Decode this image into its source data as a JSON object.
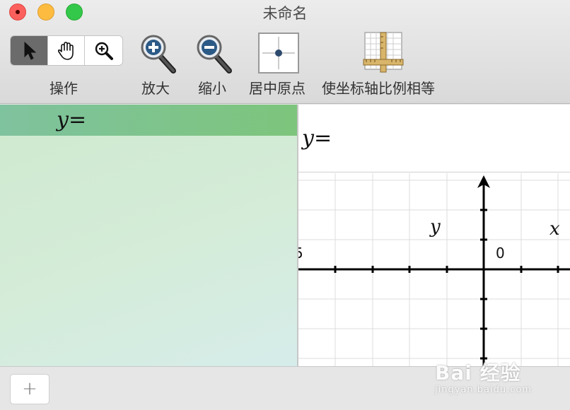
{
  "window": {
    "title": "未命名"
  },
  "toolbar": {
    "operate_label": "操作",
    "zoom_in_label": "放大",
    "zoom_out_label": "缩小",
    "center_origin_label": "居中原点",
    "equal_axes_label": "使坐标轴比例相等"
  },
  "algebra": {
    "var": "y",
    "eq": "="
  },
  "input": {
    "var": "y",
    "eq": "="
  },
  "graph": {
    "x_axis_label": "x",
    "y_axis_label": "y",
    "origin_label": "0",
    "left_tick_label": "5"
  },
  "bottom": {
    "add_label": "+"
  },
  "watermark": {
    "main": "Bai 经验",
    "sub": "jingyan.baidu.com"
  }
}
